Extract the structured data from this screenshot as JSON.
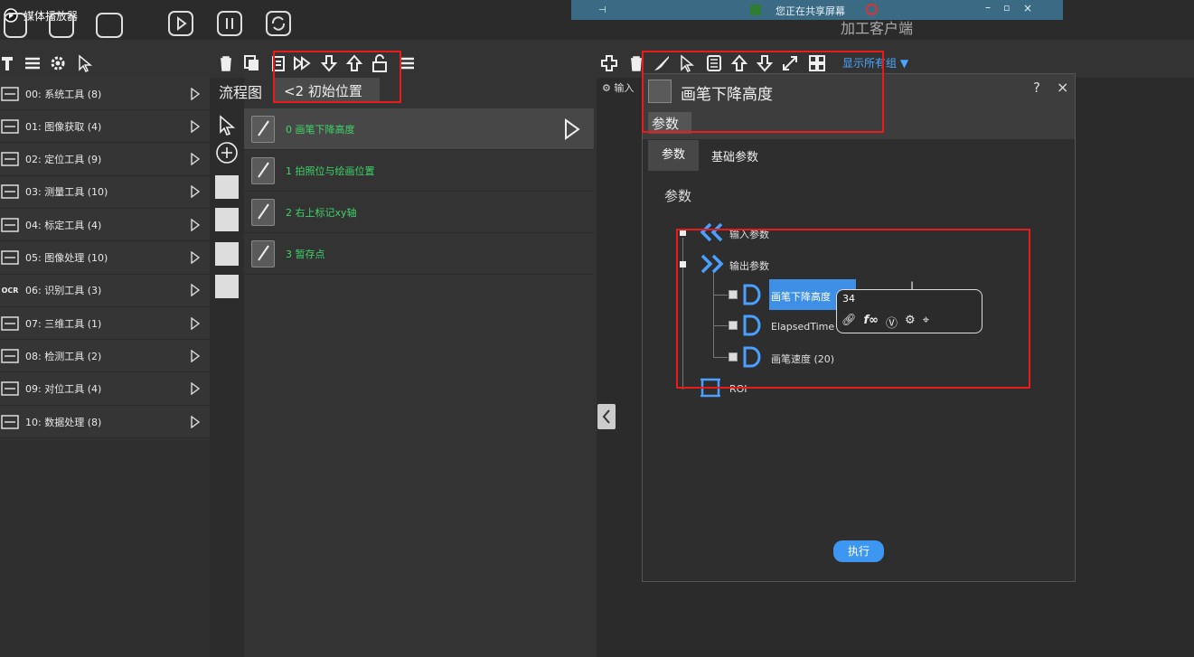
{
  "topbar": {
    "player_title": "媒体播放器",
    "share_text": "您正在共享屏幕",
    "app_title": "加工客户端"
  },
  "tools": [
    {
      "label": "00: 系统工具 (8)",
      "icon": "network-icon"
    },
    {
      "label": "01: 图像获取 (4)",
      "icon": "camera-icon"
    },
    {
      "label": "02: 定位工具 (9)",
      "icon": "locate-icon"
    },
    {
      "label": "03: 测量工具 (10)",
      "icon": "circle-measure-icon"
    },
    {
      "label": "04: 标定工具 (4)",
      "icon": "calibrate-icon"
    },
    {
      "label": "05: 图像处理 (10)",
      "icon": "image-process-icon"
    },
    {
      "label": "06: 识别工具 (3)",
      "icon": "ocr-icon"
    },
    {
      "label": "07: 三维工具 (1)",
      "icon": "3d-icon"
    },
    {
      "label": "08: 检测工具 (2)",
      "icon": "gauge-icon"
    },
    {
      "label": "09: 对位工具 (4)",
      "icon": "align-icon"
    },
    {
      "label": "10: 数据处理 (8)",
      "icon": "data-icon"
    }
  ],
  "ocr_text": "OCR",
  "flow": {
    "tab": "流程图",
    "crumb": "<2  初始位置",
    "items": [
      {
        "label": "0 画笔下降高度",
        "selected": true
      },
      {
        "label": "1 拍照位与绘画位置",
        "selected": false
      },
      {
        "label": "2 右上标记xy轴",
        "selected": false
      },
      {
        "label": "3 暂存点",
        "selected": false
      }
    ]
  },
  "right": {
    "input_label": "输入",
    "show_groups": "显示所有组"
  },
  "dialog": {
    "title": "画笔下降高度",
    "help": "?",
    "close": "×",
    "header_tab": "参数",
    "tab_params": "参数",
    "tab_basic": "基础参数",
    "section": "参数",
    "tree": {
      "input_params": "输入参数",
      "output_params": "输出参数",
      "out_item0": "画笔下降高度",
      "out_item1": "ElapsedTime (0",
      "out_item2": "画笔速度 (20)",
      "roi": "ROI"
    },
    "value_popup": "34",
    "exec_button": "执行"
  },
  "colors": {
    "accent_blue": "#3e8fe6",
    "flow_green": "#3fd468",
    "highlight_red": "#e81c1c"
  }
}
